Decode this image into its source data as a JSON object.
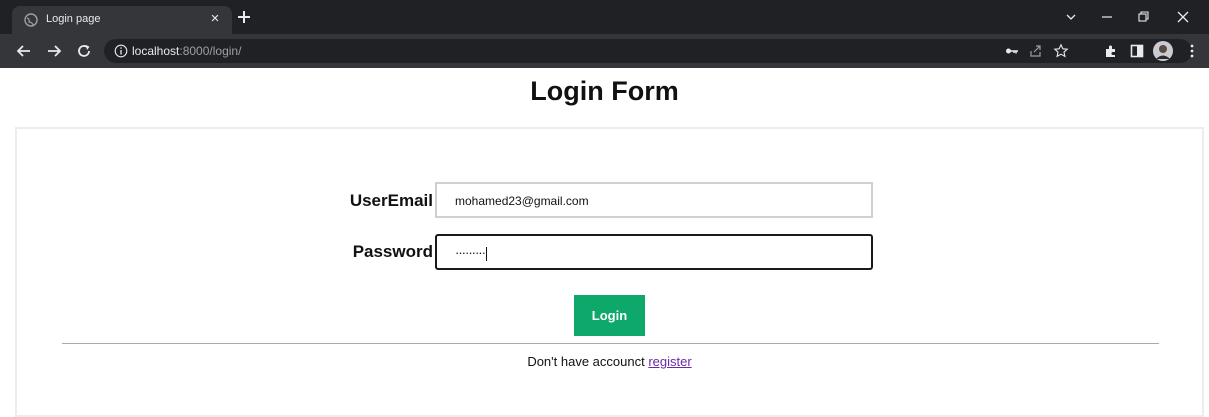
{
  "browser": {
    "tab_title": "Login page",
    "tab_close": "×",
    "url_host": "localhost",
    "url_path": ":8000/login/"
  },
  "page": {
    "title": "Login Form"
  },
  "form": {
    "email_label": "UserEmail",
    "email_value": "mohamed23@gmail.com",
    "password_label": "Password",
    "password_value": "·········",
    "login_button": "Login"
  },
  "footer": {
    "prompt": "Don't have accounct ",
    "register_link": "register"
  },
  "colors": {
    "button": "#0ea86a",
    "link": "#6a2aa8",
    "chrome_dark": "#202124",
    "chrome_toolbar": "#35363a"
  }
}
